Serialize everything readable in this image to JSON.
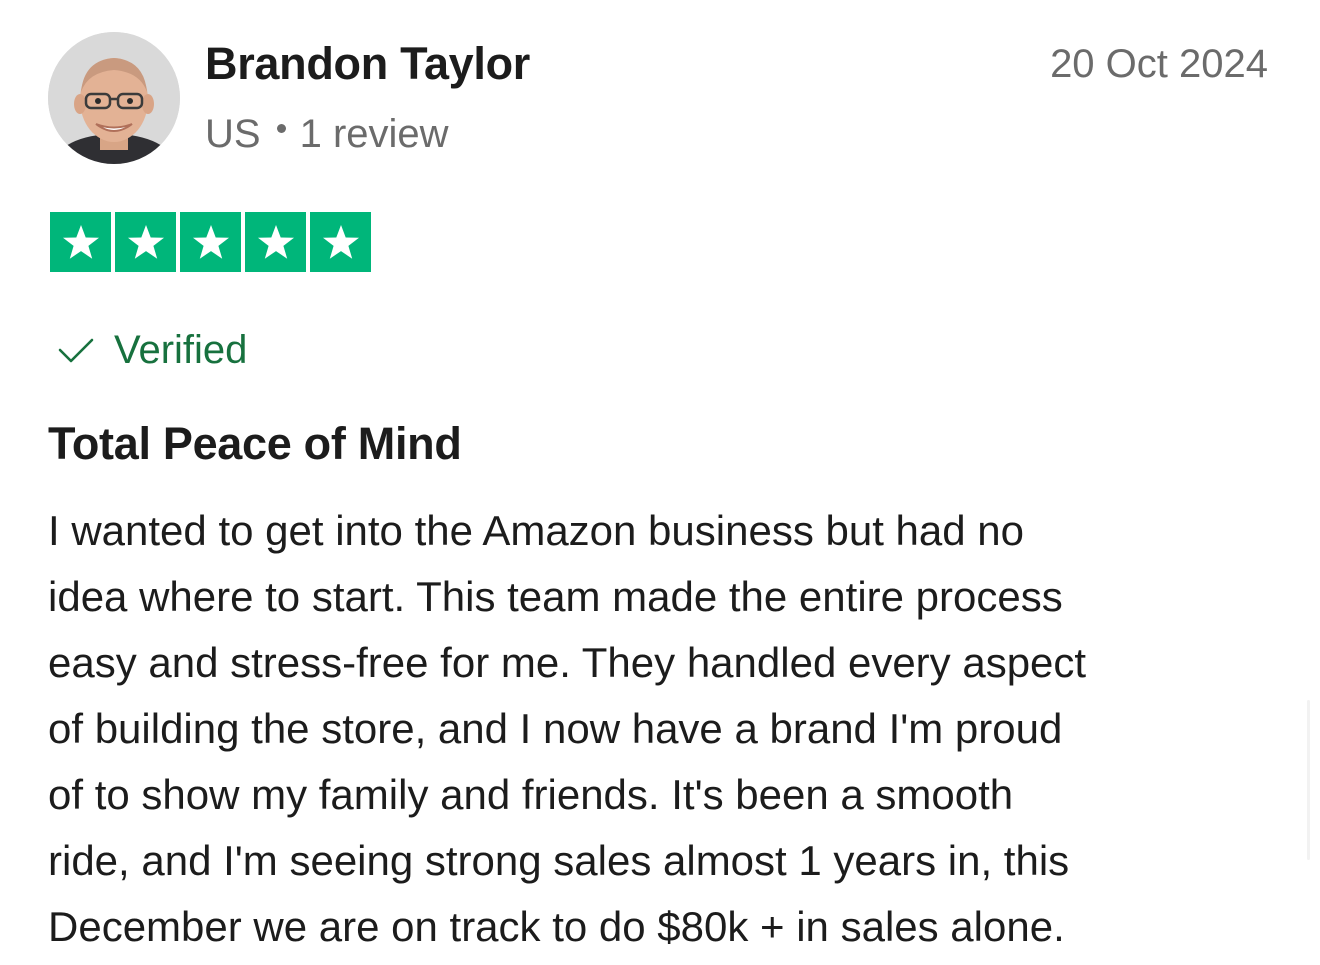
{
  "reviewer": {
    "name": "Brandon Taylor",
    "country": "US",
    "review_count": "1 review"
  },
  "review": {
    "date": "20 Oct 2024",
    "rating": 5,
    "star_color": "#00b67a",
    "verified_label": "Verified",
    "verified_color": "#17713e",
    "title": "Total Peace of Mind",
    "body_lines": [
      "I wanted to get into the Amazon business but had no",
      "idea where to start. This team made the entire process",
      "easy and stress-free for me. They handled every aspect",
      "of building the store, and I now have a brand I'm proud",
      "of to show my family and friends. It's been a smooth",
      "ride, and I'm seeing strong sales almost 1 years in, this",
      "December we are on track to do $80k + in sales alone."
    ]
  },
  "icons": {
    "avatar": "avatar-photo",
    "star": "star-icon",
    "verified": "check-icon"
  }
}
